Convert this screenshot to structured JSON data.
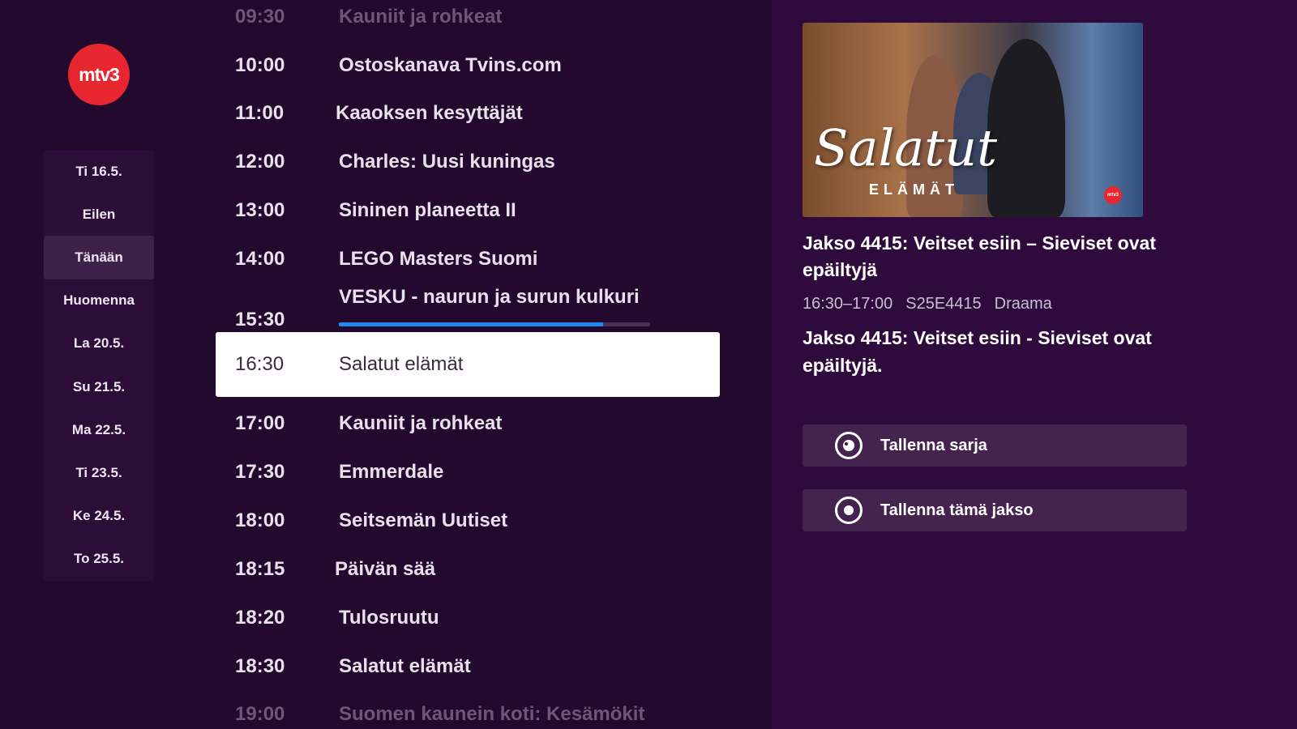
{
  "channel": {
    "logo_text": "mtv3",
    "logo_color": "#e8262f"
  },
  "dates": [
    {
      "label": "Ti 16.5.",
      "active": false
    },
    {
      "label": "Eilen",
      "active": false
    },
    {
      "label": "Tänään",
      "active": true
    },
    {
      "label": "Huomenna",
      "active": false
    },
    {
      "label": "La 20.5.",
      "active": false
    },
    {
      "label": "Su 21.5.",
      "active": false
    },
    {
      "label": "Ma 22.5.",
      "active": false
    },
    {
      "label": "Ti 23.5.",
      "active": false
    },
    {
      "label": "Ke 24.5.",
      "active": false
    },
    {
      "label": "To 25.5.",
      "active": false
    }
  ],
  "schedule": [
    {
      "time": "09:30",
      "title": "Kauniit ja rohkeat"
    },
    {
      "time": "10:00",
      "title": "Ostoskanava Tvins.com"
    },
    {
      "time": "11:00",
      "title": "Kaaoksen kesyttäjät"
    },
    {
      "time": "12:00",
      "title": "Charles: Uusi kuningas"
    },
    {
      "time": "13:00",
      "title": "Sininen planeetta II"
    },
    {
      "time": "14:00",
      "title": "LEGO Masters Suomi"
    },
    {
      "time": "15:30",
      "title": "VESKU - naurun ja surun kulkuri"
    },
    {
      "time": "16:30",
      "title": "Salatut elämät"
    },
    {
      "time": "17:00",
      "title": "Kauniit ja rohkeat"
    },
    {
      "time": "17:30",
      "title": "Emmerdale"
    },
    {
      "time": "18:00",
      "title": "Seitsemän Uutiset"
    },
    {
      "time": "18:15",
      "title": "Päivän sää"
    },
    {
      "time": "18:20",
      "title": "Tulosruutu"
    },
    {
      "time": "18:30",
      "title": "Salatut elämät"
    },
    {
      "time": "19:00",
      "title": "Suomen kaunein koti: Kesämökit"
    }
  ],
  "now_playing_progress": 0.85,
  "progress_color": "#1e8cf0",
  "detail": {
    "thumbnail_script": "Salatut",
    "thumbnail_sub": "ELÄMÄT",
    "thumbnail_badge": "mtv3",
    "episode_title": "Jakso 4415: Veitset esiin – Sieviset ovat epäiltyjä",
    "time_range": "16:30–17:00",
    "episode_code": "S25E4415",
    "genre": "Draama",
    "description": "Jakso 4415: Veitset esiin - Sieviset ovat epäiltyjä.",
    "actions": [
      {
        "label": "Tallenna sarja",
        "icon": "record-series-icon"
      },
      {
        "label": "Tallenna tämä jakso",
        "icon": "record-episode-icon"
      }
    ]
  }
}
